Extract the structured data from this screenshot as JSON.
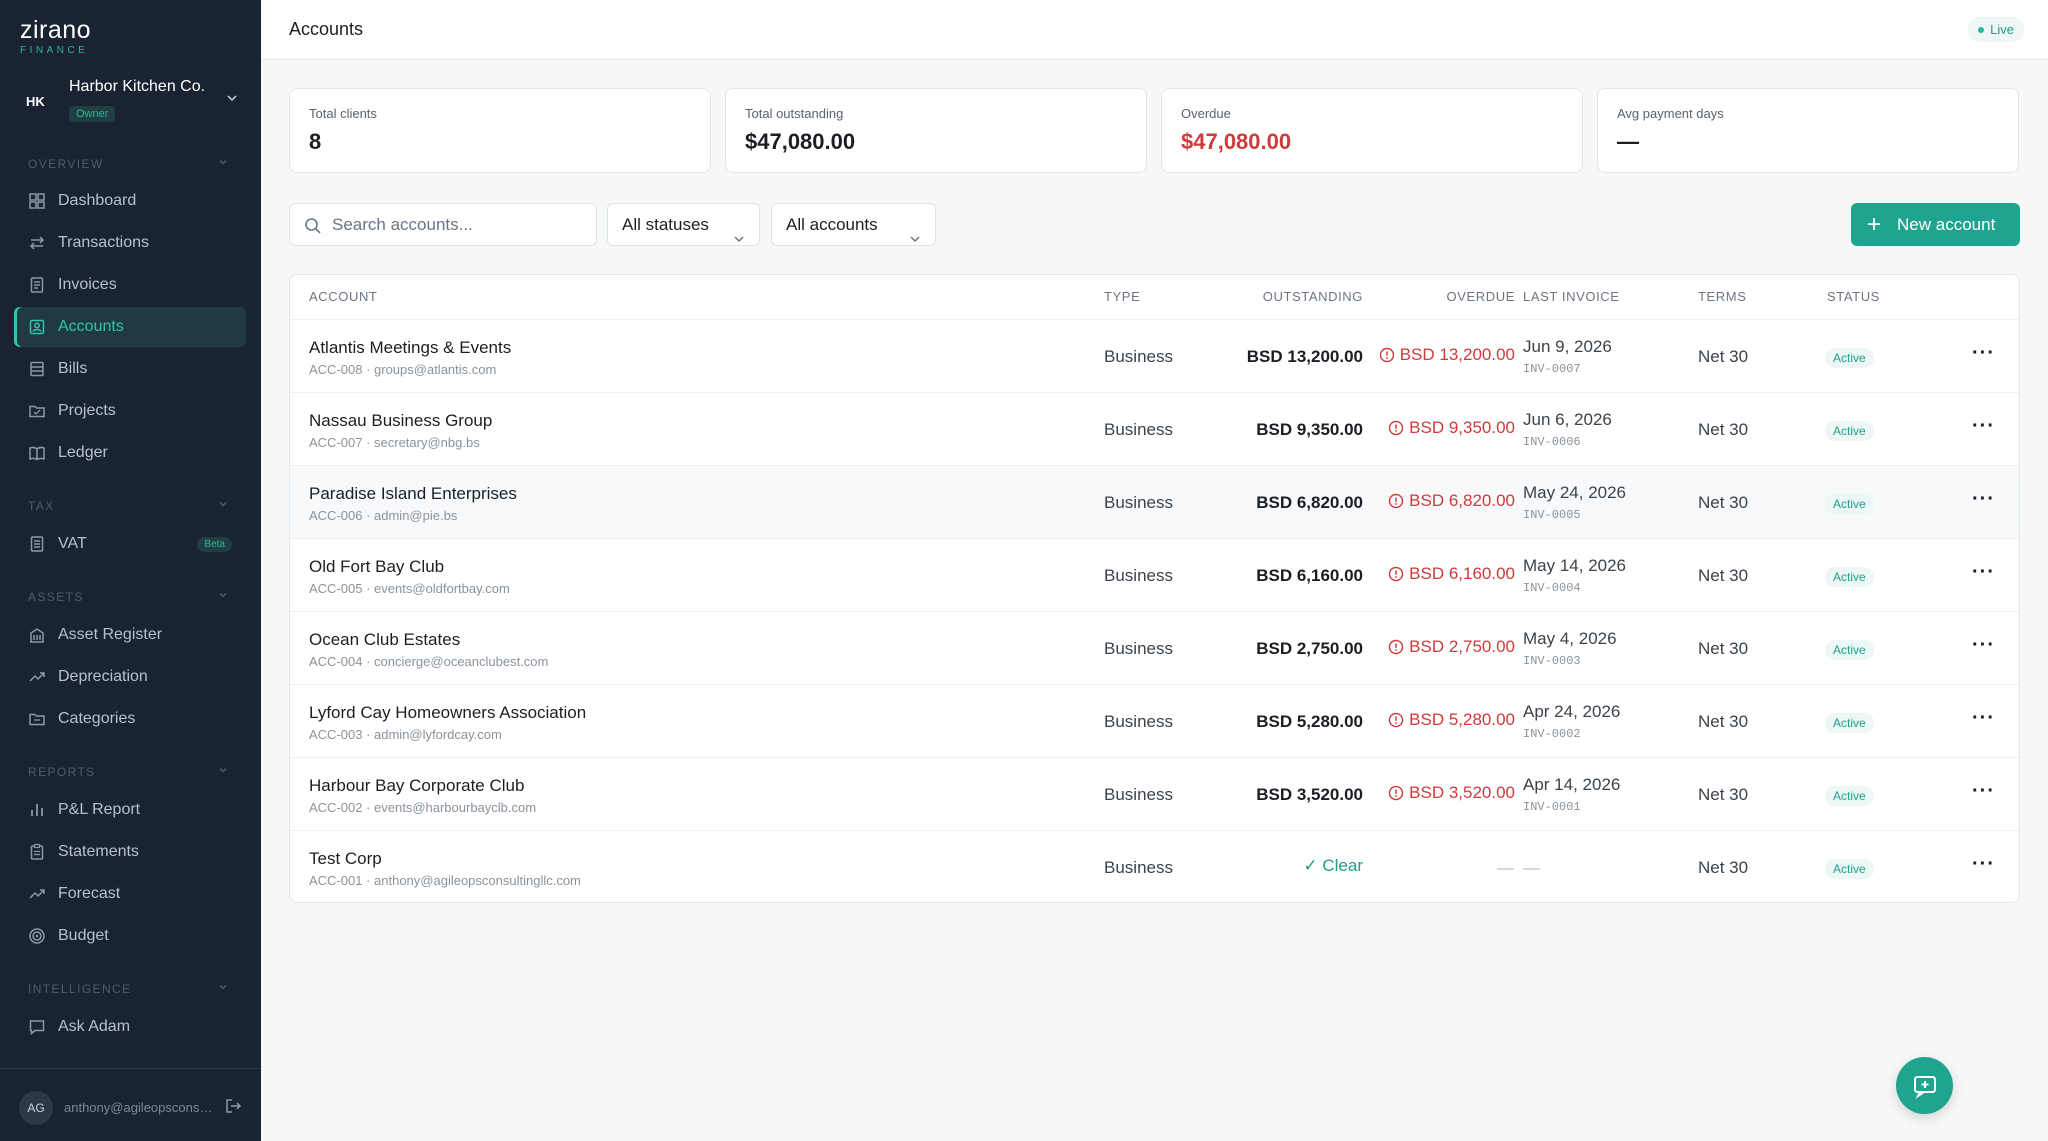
{
  "brand": {
    "logo_main": "zirano",
    "logo_sub": "FINANCE"
  },
  "org": {
    "initials": "HK",
    "name": "Harbor Kitchen Co.",
    "role": "Owner"
  },
  "sidebar": {
    "sections": [
      {
        "title": "OVERVIEW"
      },
      {
        "title": "TAX"
      },
      {
        "title": "ASSETS"
      },
      {
        "title": "REPORTS"
      },
      {
        "title": "INTELLIGENCE"
      }
    ],
    "items": [
      {
        "label": "Dashboard",
        "icon": "dashboard-icon"
      },
      {
        "label": "Transactions",
        "icon": "transactions-icon"
      },
      {
        "label": "Invoices",
        "icon": "invoice-icon"
      },
      {
        "label": "Accounts",
        "icon": "accounts-icon",
        "active": true
      },
      {
        "label": "Bills",
        "icon": "bills-icon"
      },
      {
        "label": "Projects",
        "icon": "folder-icon"
      },
      {
        "label": "Ledger",
        "icon": "book-icon"
      },
      {
        "label": "VAT",
        "icon": "document-icon",
        "badge": "Beta"
      },
      {
        "label": "Asset Register",
        "icon": "building-icon"
      },
      {
        "label": "Depreciation",
        "icon": "trend-icon"
      },
      {
        "label": "Categories",
        "icon": "folder-icon"
      },
      {
        "label": "P&L Report",
        "icon": "bar-chart-icon"
      },
      {
        "label": "Statements",
        "icon": "clipboard-icon"
      },
      {
        "label": "Forecast",
        "icon": "trend-icon"
      },
      {
        "label": "Budget",
        "icon": "target-icon"
      },
      {
        "label": "Ask Adam",
        "icon": "chat-icon"
      }
    ]
  },
  "user": {
    "initials": "AG",
    "email": "anthony@agileopsconsultingllc.com"
  },
  "header": {
    "title": "Accounts",
    "live": "Live"
  },
  "stats": [
    {
      "label": "Total clients",
      "value": "8"
    },
    {
      "label": "Total outstanding",
      "value": "$47,080.00"
    },
    {
      "label": "Overdue",
      "value": "$47,080.00"
    },
    {
      "label": "Avg payment days",
      "value": "—"
    }
  ],
  "toolbar": {
    "search_placeholder": "Search accounts...",
    "status_filter": "All statuses",
    "account_filter": "All accounts",
    "new_button": "New account"
  },
  "table": {
    "columns": [
      "ACCOUNT",
      "TYPE",
      "OUTSTANDING",
      "OVERDUE",
      "LAST INVOICE",
      "TERMS",
      "STATUS"
    ],
    "rows": [
      {
        "name": "Atlantis Meetings & Events",
        "sub": "ACC-008 · groups@atlantis.com",
        "type": "Business",
        "outstanding": "BSD 13,200.00",
        "overdue": "BSD 13,200.00",
        "inv_date": "Jun 9, 2026",
        "inv_num": "INV-0007",
        "terms": "Net 30",
        "status": "Active"
      },
      {
        "name": "Nassau Business Group",
        "sub": "ACC-007 · secretary@nbg.bs",
        "type": "Business",
        "outstanding": "BSD 9,350.00",
        "overdue": "BSD 9,350.00",
        "inv_date": "Jun 6, 2026",
        "inv_num": "INV-0006",
        "terms": "Net 30",
        "status": "Active"
      },
      {
        "name": "Paradise Island Enterprises",
        "sub": "ACC-006 · admin@pie.bs",
        "type": "Business",
        "outstanding": "BSD 6,820.00",
        "overdue": "BSD 6,820.00",
        "inv_date": "May 24, 2026",
        "inv_num": "INV-0005",
        "terms": "Net 30",
        "status": "Active"
      },
      {
        "name": "Old Fort Bay Club",
        "sub": "ACC-005 · events@oldfortbay.com",
        "type": "Business",
        "outstanding": "BSD 6,160.00",
        "overdue": "BSD 6,160.00",
        "inv_date": "May 14, 2026",
        "inv_num": "INV-0004",
        "terms": "Net 30",
        "status": "Active"
      },
      {
        "name": "Ocean Club Estates",
        "sub": "ACC-004 · concierge@oceanclubest.com",
        "type": "Business",
        "outstanding": "BSD 2,750.00",
        "overdue": "BSD 2,750.00",
        "inv_date": "May 4, 2026",
        "inv_num": "INV-0003",
        "terms": "Net 30",
        "status": "Active"
      },
      {
        "name": "Lyford Cay Homeowners Association",
        "sub": "ACC-003 · admin@lyfordcay.com",
        "type": "Business",
        "outstanding": "BSD 5,280.00",
        "overdue": "BSD 5,280.00",
        "inv_date": "Apr 24, 2026",
        "inv_num": "INV-0002",
        "terms": "Net 30",
        "status": "Active"
      },
      {
        "name": "Harbour Bay Corporate Club",
        "sub": "ACC-002 · events@harbourbayclb.com",
        "type": "Business",
        "outstanding": "BSD 3,520.00",
        "overdue": "BSD 3,520.00",
        "inv_date": "Apr 14, 2026",
        "inv_num": "INV-0001",
        "terms": "Net 30",
        "status": "Active"
      },
      {
        "name": "Test Corp",
        "sub": "ACC-001 · anthony@agileopsconsultingllc.com",
        "type": "Business",
        "clear": "Clear",
        "dash": "— —",
        "terms": "Net 30",
        "status": "Active"
      }
    ]
  },
  "colors": {
    "accent": "#1fa58f",
    "danger": "#d03a3a",
    "sidebar_bg": "#1a2332"
  }
}
